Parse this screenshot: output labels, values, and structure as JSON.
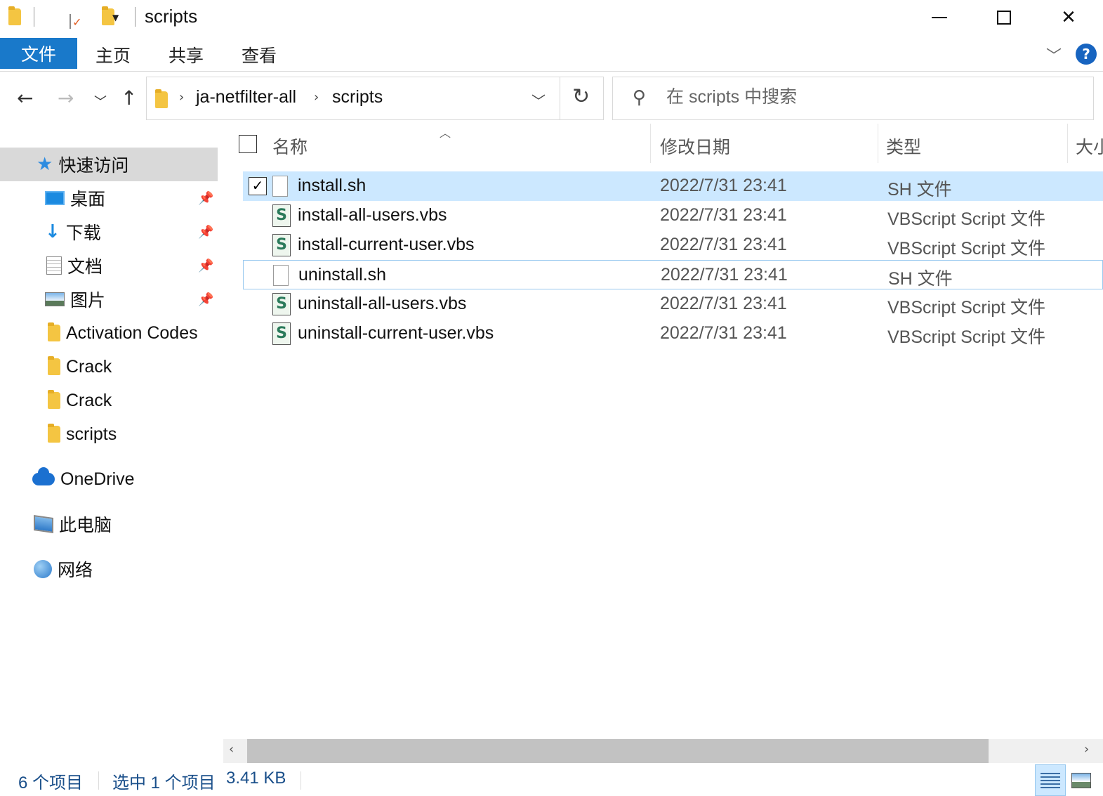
{
  "window": {
    "title": "scripts",
    "controls": {
      "minimize": "—",
      "maximize": "☐",
      "close": "✕"
    }
  },
  "ribbon": {
    "file_tab": "文件",
    "tabs": [
      "主页",
      "共享",
      "查看"
    ],
    "help": "?"
  },
  "address": {
    "crumbs": [
      "ja-netfilter-all",
      "scripts"
    ]
  },
  "search": {
    "placeholder": "在 scripts 中搜索"
  },
  "sidebar": {
    "quick_access": "快速访问",
    "pinned": [
      {
        "label": "桌面",
        "icon": "desktop-icon"
      },
      {
        "label": "下载",
        "icon": "download-icon"
      },
      {
        "label": "文档",
        "icon": "document-icon"
      },
      {
        "label": "图片",
        "icon": "pictures-icon"
      }
    ],
    "folders": [
      "Activation Codes",
      "Crack",
      "Crack",
      "scripts"
    ],
    "onedrive": "OneDrive",
    "this_pc": "此电脑",
    "network": "网络"
  },
  "columns": {
    "name": "名称",
    "date": "修改日期",
    "type": "类型",
    "size": "大小"
  },
  "files": [
    {
      "name": "install.sh",
      "date": "2022/7/31 23:41",
      "type": "SH 文件",
      "icon": "file-icon",
      "selected": true
    },
    {
      "name": "install-all-users.vbs",
      "date": "2022/7/31 23:41",
      "type": "VBScript Script 文件",
      "icon": "vbs-icon"
    },
    {
      "name": "install-current-user.vbs",
      "date": "2022/7/31 23:41",
      "type": "VBScript Script 文件",
      "icon": "vbs-icon"
    },
    {
      "name": "uninstall.sh",
      "date": "2022/7/31 23:41",
      "type": "SH 文件",
      "icon": "file-icon",
      "focused": true
    },
    {
      "name": "uninstall-all-users.vbs",
      "date": "2022/7/31 23:41",
      "type": "VBScript Script 文件",
      "icon": "vbs-icon"
    },
    {
      "name": "uninstall-current-user.vbs",
      "date": "2022/7/31 23:41",
      "type": "VBScript Script 文件",
      "icon": "vbs-icon"
    }
  ],
  "status": {
    "item_count": "6 个项目",
    "selection": "选中 1 个项目",
    "size": "3.41 KB"
  },
  "colors": {
    "accent": "#1979ca",
    "selected_row": "#cce8ff",
    "sidebar_active": "#d9d9d9"
  }
}
